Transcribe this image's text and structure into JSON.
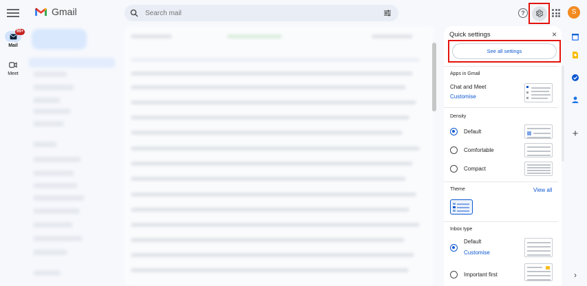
{
  "app": {
    "logo_text": "Gmail",
    "avatar_letter": "S",
    "avatar_color": "#f28b20",
    "highlight_color": "#e3120b"
  },
  "search": {
    "placeholder": "Search mail"
  },
  "rail": {
    "mail_label": "Mail",
    "mail_badge": "99+",
    "meet_label": "Meet"
  },
  "quick_settings": {
    "title": "Quick settings",
    "close_glyph": "×",
    "see_all_label": "See all settings",
    "apps_section": "Apps in Gmail",
    "chat_meet_label": "Chat and Meet",
    "chat_meet_customise": "Customise",
    "density_section": "Density",
    "density_options": [
      {
        "label": "Default",
        "selected": true
      },
      {
        "label": "Comfortable",
        "selected": false
      },
      {
        "label": "Compact",
        "selected": false
      }
    ],
    "theme_section": "Theme",
    "theme_view_all": "View all",
    "inbox_section": "Inbox type",
    "inbox_options": [
      {
        "label": "Default",
        "selected": true,
        "link": "Customise"
      },
      {
        "label": "Important first",
        "selected": false
      }
    ]
  },
  "right_sidebar": {
    "icons": [
      "calendar-icon",
      "keep-icon",
      "tasks-icon",
      "contacts-icon",
      "add-addon-icon",
      "expand-icon"
    ],
    "add_glyph": "+",
    "expand_glyph": "›"
  }
}
